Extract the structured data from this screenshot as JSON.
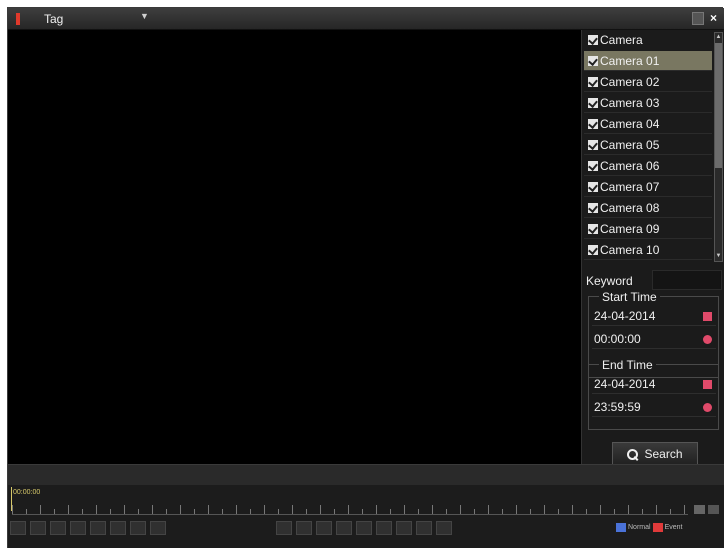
{
  "topbar": {
    "title": "Tag",
    "dropdown_icon": "chevron-down-icon",
    "close_icon": "close-icon",
    "close_glyph": "×"
  },
  "cameras": {
    "header": "Camera",
    "items": [
      {
        "label": "Camera 01",
        "selected": true
      },
      {
        "label": "Camera 02",
        "selected": false
      },
      {
        "label": "Camera 03",
        "selected": false
      },
      {
        "label": "Camera 04",
        "selected": false
      },
      {
        "label": "Camera 05",
        "selected": false
      },
      {
        "label": "Camera 06",
        "selected": false
      },
      {
        "label": "Camera 07",
        "selected": false
      },
      {
        "label": "Camera 08",
        "selected": false
      },
      {
        "label": "Camera 09",
        "selected": false
      },
      {
        "label": "Camera 10",
        "selected": false
      }
    ]
  },
  "search": {
    "keyword_label": "Keyword",
    "keyword_value": "",
    "start_time": {
      "title": "Start Time",
      "date": "24-04-2014",
      "time": "00:00:00"
    },
    "end_time": {
      "title": "End Time",
      "date": "24-04-2014",
      "time": "23:59:59"
    },
    "button_label": "Search",
    "button_icon": "search-icon"
  },
  "timeline": {
    "start_label": "00:00:00",
    "legend": [
      {
        "label": "Normal",
        "color": "#4a72d8"
      },
      {
        "label": "Event",
        "color": "#e03a3a"
      }
    ]
  },
  "colors": {
    "selected_row": "#797761",
    "accent_icon": "#e04a6a"
  }
}
